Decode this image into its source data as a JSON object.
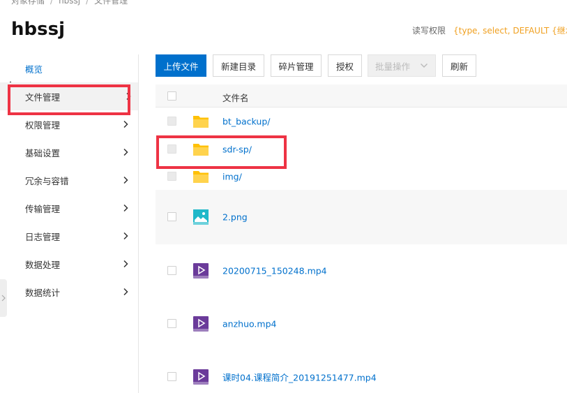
{
  "breadcrumb": [
    "对象存储",
    "hbssj",
    "文件管理"
  ],
  "bucket": {
    "name": "hbssj",
    "perm_label": "读写权限",
    "perm_value": "{type, select, DEFAULT {继承"
  },
  "sidebar": {
    "items": [
      {
        "label": "概览",
        "has_arrow": false
      },
      {
        "label": "文件管理",
        "has_arrow": true
      },
      {
        "label": "权限管理",
        "has_arrow": true
      },
      {
        "label": "基础设置",
        "has_arrow": true
      },
      {
        "label": "冗余与容错",
        "has_arrow": true
      },
      {
        "label": "传输管理",
        "has_arrow": true
      },
      {
        "label": "日志管理",
        "has_arrow": true
      },
      {
        "label": "数据处理",
        "has_arrow": true
      },
      {
        "label": "数据统计",
        "has_arrow": true
      }
    ]
  },
  "toolbar": {
    "upload": "上传文件",
    "new_dir": "新建目录",
    "fragments": "碎片管理",
    "authorize": "授权",
    "batch": "批量操作",
    "refresh": "刷新"
  },
  "table": {
    "header_name": "文件名",
    "rows": [
      {
        "name": "bt_backup/",
        "type": "folder"
      },
      {
        "name": "sdr-sp/",
        "type": "folder"
      },
      {
        "name": "img/",
        "type": "folder"
      },
      {
        "name": "2.png",
        "type": "image"
      },
      {
        "name": "20200715_150248.mp4",
        "type": "video"
      },
      {
        "name": "anzhuo.mp4",
        "type": "video"
      },
      {
        "name": "课时04.课程简介_20191251477.mp4",
        "type": "video"
      }
    ]
  },
  "icons": {
    "folder": "folder-icon",
    "image": "image-file-icon",
    "video": "video-file-icon",
    "chevron": "chevron-right-icon",
    "dropdown": "chevron-down-icon",
    "handle": "collapse-handle-icon"
  },
  "colors": {
    "accent": "#0070cc",
    "permission": "#f0a020",
    "annotation": "#ee3344",
    "folder": "#ffc107",
    "image_icon": "#1fb8c9",
    "video_icon": "#6b3b9a"
  }
}
